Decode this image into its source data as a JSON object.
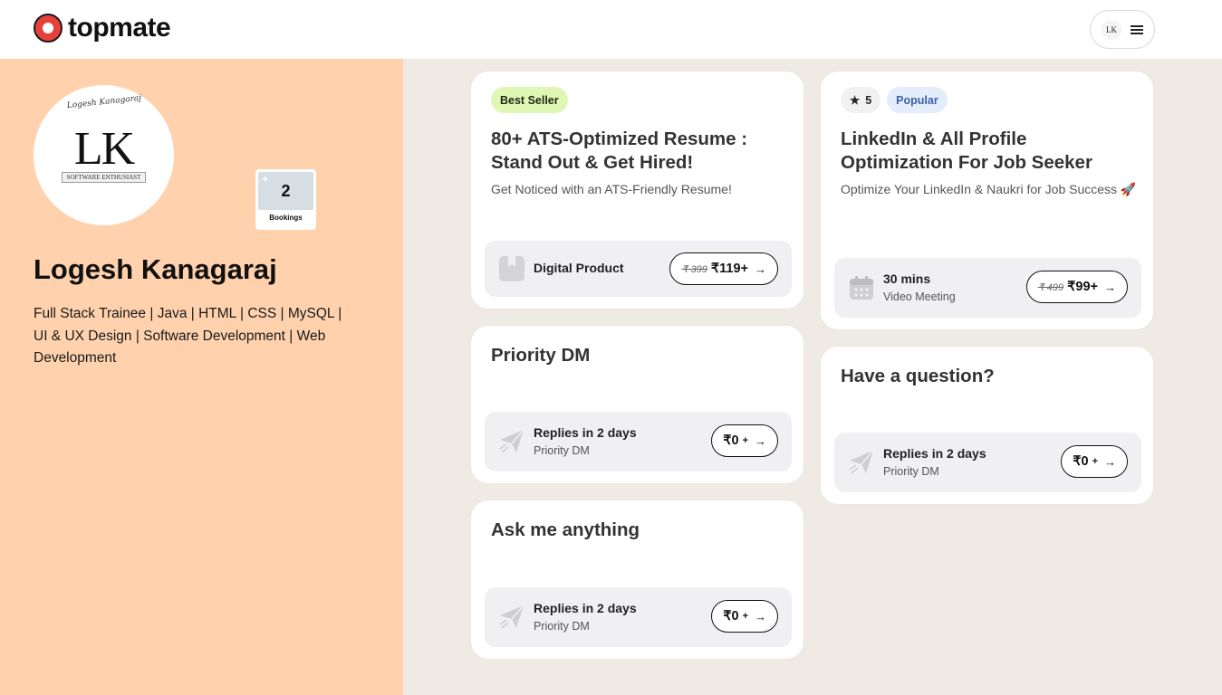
{
  "header": {
    "brand": "topmate",
    "user_initials": "LK"
  },
  "profile": {
    "avatar_initials": "LK",
    "avatar_signature": "Logesh Kanagaraj",
    "avatar_tagline": "SOFTWARE ENTHUSIAST",
    "bookings_count": "2",
    "bookings_label": "Bookings",
    "name": "Logesh Kanagaraj",
    "bio": "Full Stack Trainee | Java | HTML | CSS | MySQL | UI & UX Design | Software Development | Web Development"
  },
  "cards": {
    "resume": {
      "badge": "Best Seller",
      "title": "80+ ATS-Optimized Resume : Stand Out & Get Hired!",
      "description": "Get Noticed with an ATS-Friendly Resume!",
      "footer_main": "Digital Product",
      "old_price": "₹ 399",
      "price": "₹119+",
      "icon": "bookmark-icon"
    },
    "linkedin": {
      "rating": "5",
      "badge": "Popular",
      "title": "LinkedIn & All Profile Optimization For Job Seeker",
      "description": "Optimize Your LinkedIn & Naukri for Job Success 🚀",
      "footer_main": "30 mins",
      "footer_sub": "Video Meeting",
      "old_price": "₹ 499",
      "price": "₹99+",
      "icon": "calendar-icon"
    },
    "priority_dm": {
      "title": "Priority DM",
      "footer_main": "Replies in 2 days",
      "footer_sub": "Priority DM",
      "price": "₹0",
      "plus": "+",
      "icon": "paper-plane-icon"
    },
    "question": {
      "title": "Have a question?",
      "footer_main": "Replies in 2 days",
      "footer_sub": "Priority DM",
      "price": "₹0",
      "plus": "+",
      "icon": "paper-plane-icon"
    },
    "ask": {
      "title": "Ask me anything",
      "footer_main": "Replies in 2 days",
      "footer_sub": "Priority DM",
      "price": "₹0",
      "plus": "+",
      "icon": "paper-plane-icon"
    }
  },
  "colors": {
    "left_panel": "#ffd2ad",
    "right_panel": "#efebe4",
    "brand_red": "#e8413b",
    "best_seller_badge": "#dff7b4",
    "popular_badge": "#e3edfb"
  }
}
